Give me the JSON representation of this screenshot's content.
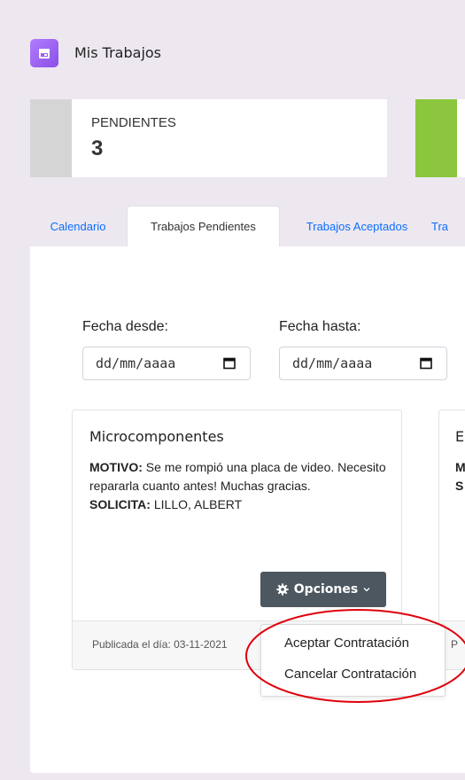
{
  "page": {
    "title": "Mis Trabajos",
    "icon": "calendar-icon"
  },
  "stats": [
    {
      "label": "PENDIENTES",
      "value": "3",
      "color": "#d5d5d5"
    },
    {
      "label": "",
      "value": "",
      "color": "#8cc63f"
    }
  ],
  "tabs": [
    {
      "label": "Calendario",
      "active": false
    },
    {
      "label": "Trabajos Pendientes",
      "active": true
    },
    {
      "label": "Trabajos Aceptados",
      "active": false
    },
    {
      "label": "Tra",
      "active": false
    }
  ],
  "filters": {
    "desde_label": "Fecha desde:",
    "hasta_label": "Fecha hasta:",
    "date_placeholder": "dd/mm/aaaa"
  },
  "cards": [
    {
      "title": "Microcomponentes",
      "motivo_label": "MOTIVO:",
      "motivo": "Se me rompió una placa de video. Necesito repararla cuanto antes! Muchas gracias.",
      "solicita_label": "SOLICITA:",
      "solicita": "LILLO, ALBERT",
      "footer": "Publicada el día: 03-11-2021"
    },
    {
      "title": "E",
      "motivo_label": "M",
      "solicita_label": "S",
      "footer": "P"
    }
  ],
  "options_button": {
    "label": "Opciones"
  },
  "dropdown": {
    "items": [
      "Aceptar Contratación",
      "Cancelar Contratación"
    ]
  },
  "annotation": {
    "color": "#e0000c"
  }
}
